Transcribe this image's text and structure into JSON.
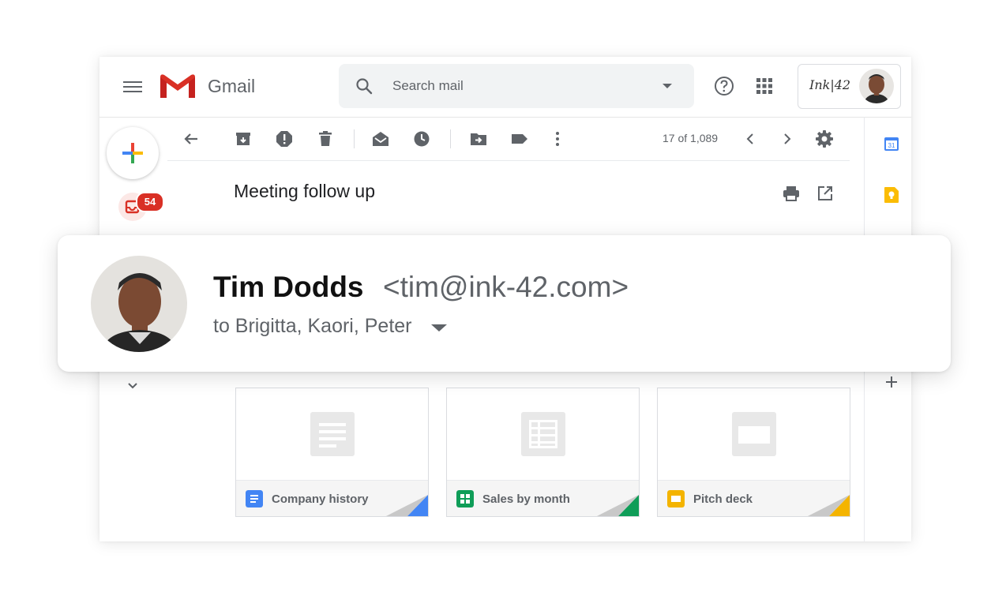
{
  "app": {
    "name": "Gmail",
    "account_brand": "Ink|42"
  },
  "search": {
    "placeholder": "Search mail"
  },
  "sidebar": {
    "inbox_badge": "54"
  },
  "toolbar": {
    "pager_count": "17 of 1,089"
  },
  "message": {
    "subject": "Meeting follow up",
    "sender_name": "Tim Dodds",
    "sender_email": "<tim@ink-42.com>",
    "recipients": "to Brigitta, Kaori, Peter"
  },
  "attachments": [
    {
      "name": "Company history",
      "type": "docs",
      "color": "#4285f4"
    },
    {
      "name": "Sales by month",
      "type": "sheets",
      "color": "#0f9d58"
    },
    {
      "name": "Pitch deck",
      "type": "slides",
      "color": "#f4b400"
    }
  ],
  "colors": {
    "gmail_red": "#d93025",
    "google_blue": "#4285f4",
    "google_green": "#34a853",
    "google_yellow": "#fbbc04"
  }
}
